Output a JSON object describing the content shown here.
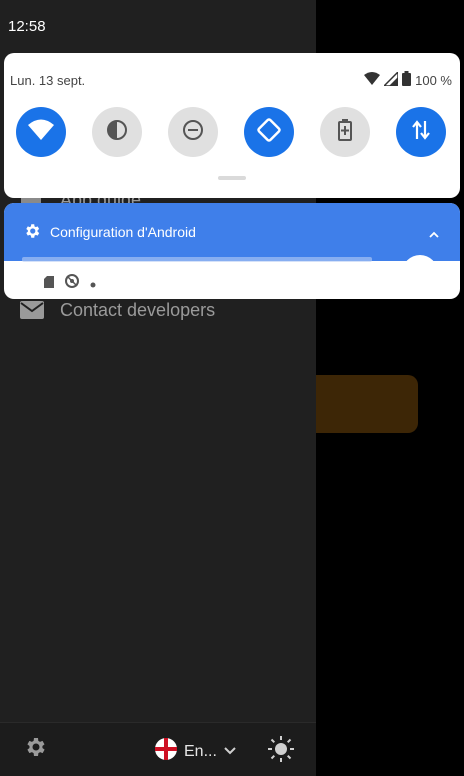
{
  "status_bar": {
    "time": "12:58"
  },
  "quick_settings": {
    "date": "Lun. 13 sept.",
    "battery_percent": "100 %",
    "tiles": [
      {
        "icon": "wifi-icon",
        "active": true
      },
      {
        "icon": "invert-colors-icon",
        "active": false
      },
      {
        "icon": "do-not-disturb-icon",
        "active": false
      },
      {
        "icon": "auto-rotate-icon",
        "active": true
      },
      {
        "icon": "battery-saver-icon",
        "active": false
      },
      {
        "icon": "mobile-data-icon",
        "active": true
      }
    ]
  },
  "notification": {
    "title": "Configuration d'Android"
  },
  "drawer": {
    "partial_item": "App guide",
    "items": [
      {
        "label": "Contact developers",
        "icon": "mail-icon"
      }
    ]
  },
  "bottom_bar": {
    "language": "En..."
  },
  "colors": {
    "accent": "#1a73e8",
    "notification_header": "#3f7fea",
    "drawer_bg": "#202020"
  }
}
